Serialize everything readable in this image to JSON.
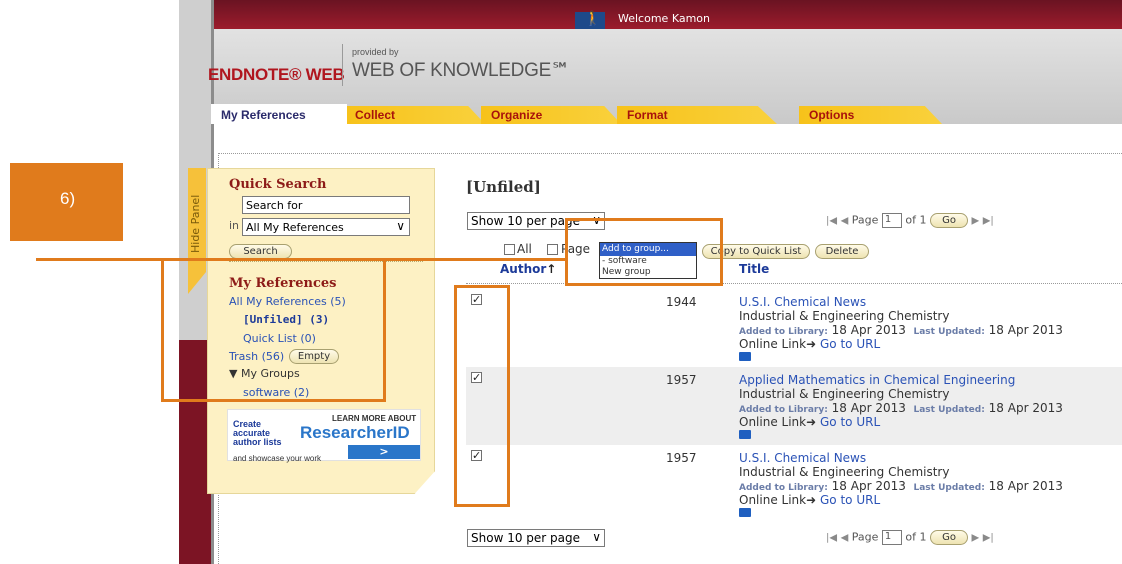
{
  "callout": {
    "label": "6)"
  },
  "header": {
    "welcome": "Welcome Kamon",
    "logo": "ENDNOTE® WEB",
    "provided_by": "provided by",
    "wok": "WEB OF KNOWLEDGE℠"
  },
  "tabs": [
    {
      "label": "My References"
    },
    {
      "label": "Collect"
    },
    {
      "label": "Organize"
    },
    {
      "label": "Format"
    },
    {
      "label": "Options"
    }
  ],
  "sidebar": {
    "hide_panel": "Hide Panel",
    "quick_search_title": "Quick Search",
    "search_value": "Search for",
    "in_label": "in",
    "scope_value": "All My References",
    "search_button": "Search",
    "my_references_title": "My References",
    "all_refs": "All My References (5)",
    "unfiled": "[Unfiled] (3)",
    "quick_list": "Quick List (0)",
    "trash": "Trash (56)",
    "empty_button": "Empty",
    "my_groups": "My Groups",
    "group_software": "software (2)"
  },
  "banner": {
    "create_line1": "Create",
    "create_line2": "accurate",
    "create_line3": "author lists",
    "showcase": "and showcase your work",
    "learn_more": "LEARN MORE ABOUT",
    "researcher_id": "ResearcherID",
    "go_symbol": ">"
  },
  "main": {
    "title": "[Unfiled]",
    "per_page": "Show 10 per page",
    "page_label": "Page",
    "page_value": "1",
    "of_label": "of 1",
    "go_button": "Go",
    "all_label": "All",
    "page_check_label": "Page",
    "copy_quick_list": "Copy to Quick List",
    "delete_button": "Delete",
    "dropdown_options": [
      "Add to group...",
      "- software",
      "New group"
    ],
    "col_author": "Author",
    "col_title": "Title",
    "added_label": "Added to Library:",
    "updated_label": "Last Updated:",
    "online_link": "Online Link",
    "go_to_url": "Go to URL"
  },
  "rows": [
    {
      "year": "1944",
      "title": "U.S.I. Chemical News",
      "journal": "Industrial & Engineering Chemistry",
      "added": "18 Apr 2013",
      "updated": "18 Apr 2013"
    },
    {
      "year": "1957",
      "title": "Applied Mathematics in Chemical Engineering",
      "journal": "Industrial & Engineering Chemistry",
      "added": "18 Apr 2013",
      "updated": "18 Apr 2013"
    },
    {
      "year": "1957",
      "title": "U.S.I. Chemical News",
      "journal": "Industrial & Engineering Chemistry",
      "added": "18 Apr 2013",
      "updated": "18 Apr 2013"
    }
  ],
  "colors": {
    "accent_orange": "#e07b1c",
    "brand_red": "#b0161f",
    "maroon": "#7c1424",
    "tab_yellow": "#f7c21a",
    "link_blue": "#2a52b6"
  }
}
